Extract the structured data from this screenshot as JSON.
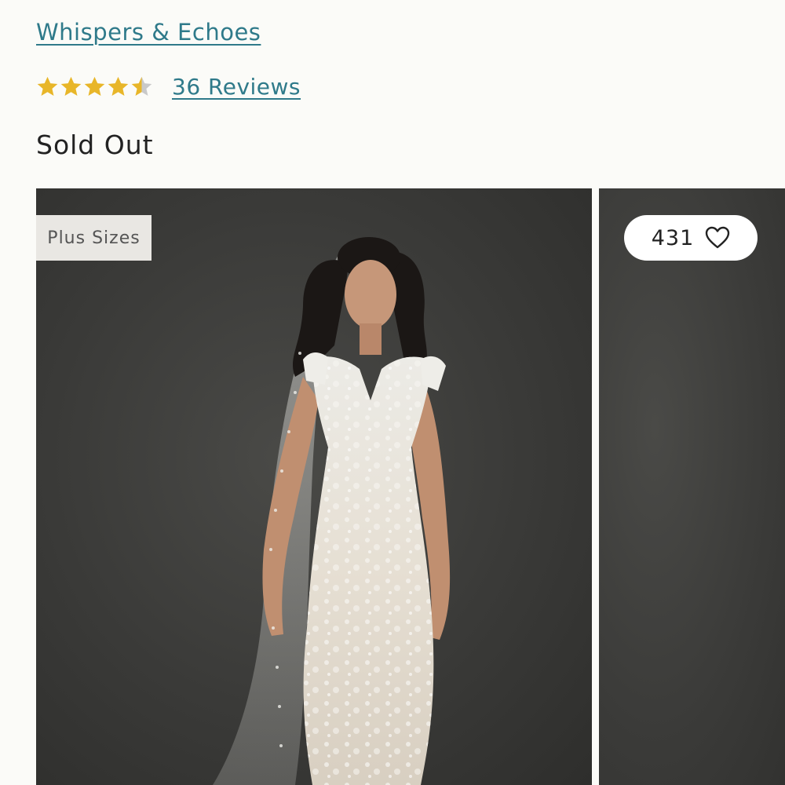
{
  "product": {
    "brand": "Whispers & Echoes",
    "rating": 4.5,
    "rating_max": 5,
    "reviews_label": "36 Reviews",
    "availability": "Sold Out"
  },
  "gallery": {
    "badge": "Plus Sizes",
    "favorites_count": "431",
    "favorite_icon": "heart-outline-icon"
  },
  "colors": {
    "link": "#2f7a8a",
    "star_filled": "#e8b629",
    "star_empty": "#c9c9c9",
    "photo_background": "#3a3a38"
  }
}
